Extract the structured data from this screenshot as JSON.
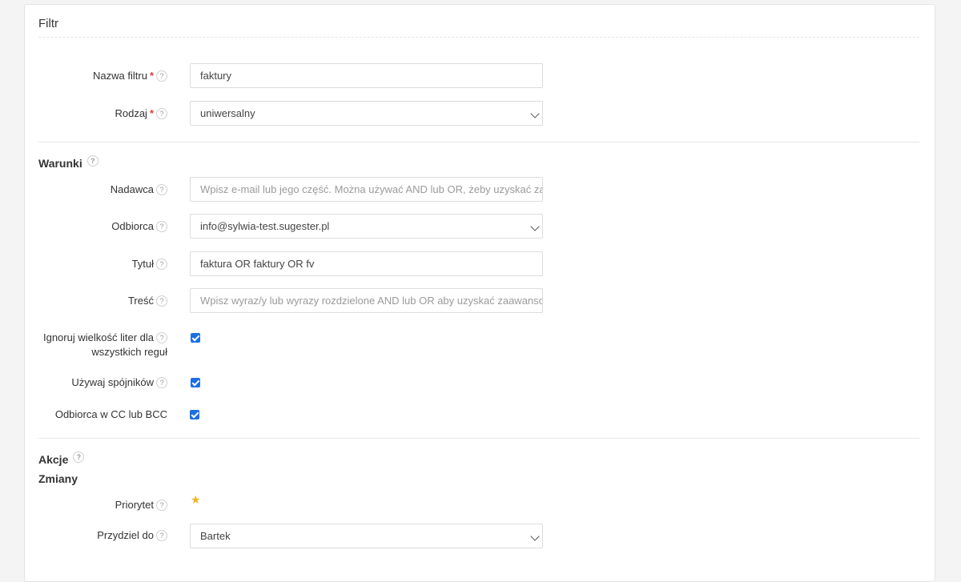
{
  "filter": {
    "title": "Filtr",
    "name_label": "Nazwa filtru",
    "name_value": "faktury",
    "type_label": "Rodzaj",
    "type_value": "uniwersalny",
    "required_mark": "*",
    "help_glyph": "?"
  },
  "conditions": {
    "title": "Warunki",
    "sender_label": "Nadawca",
    "sender_placeholder": "Wpisz e-mail lub jego część. Można używać AND lub OR, żeby uzyskać zaawansowane wyszukiwanie",
    "recipient_label": "Odbiorca",
    "recipient_value": "info@sylwia-test.sugester.pl",
    "subject_label": "Tytuł",
    "subject_value": "faktura OR faktury OR fv",
    "body_label": "Treść",
    "body_placeholder": "Wpisz wyraz/y lub wyrazy rozdzielone AND lub OR aby uzyskać zaawansowane wyszukiwanie",
    "ignore_case_label_line1": "Ignoruj wielkość liter dla",
    "ignore_case_label_line2": "wszystkich reguł",
    "ignore_case_checked": true,
    "use_conjunctions_label": "Używaj spójników",
    "use_conjunctions_checked": true,
    "cc_bcc_label": "Odbiorca w CC lub BCC",
    "cc_bcc_checked": true
  },
  "actions": {
    "title": "Akcje",
    "changes_title": "Zmiany",
    "priority_label": "Priorytet",
    "priority_star": "★",
    "assign_label": "Przydziel do",
    "assign_value": "Bartek"
  },
  "colors": {
    "accent": "#1b6fe0",
    "required": "#e03a3a",
    "star": "#f0b323"
  }
}
